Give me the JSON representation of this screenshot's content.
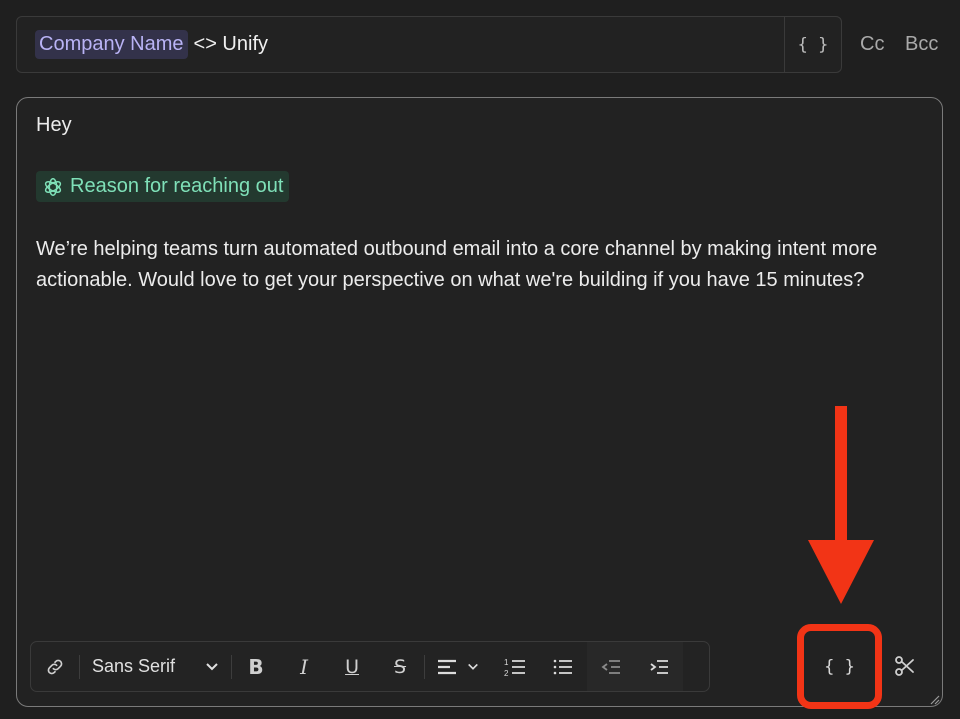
{
  "subject": {
    "variable_chip": "Company Name",
    "text": "<> Unify",
    "variables_button": "{ }"
  },
  "recipients": {
    "cc": "Cc",
    "bcc": "Bcc"
  },
  "body": {
    "greeting": "Hey",
    "ai_chip": "Reason for reaching out",
    "paragraph": "We’re helping teams turn automated outbound email into a core channel by making intent more actionable. Would love to get your perspective on what we're building if you have 15 minutes?"
  },
  "toolbar": {
    "font_family": "Sans Serif",
    "bold": "B",
    "italic": "I",
    "underline": "U",
    "strike": "S",
    "variables_button": "{ }"
  },
  "colors": {
    "variable_chip_bg": "#33324a",
    "ai_chip_text": "#7fe0b8",
    "annotation_red": "#f23416"
  },
  "icons": [
    "link-icon",
    "chevron-down-icon",
    "align-left-icon",
    "numbered-list-icon",
    "bullet-list-icon",
    "outdent-icon",
    "indent-icon",
    "scissors-icon",
    "openai-icon",
    "resize-handle-icon"
  ]
}
